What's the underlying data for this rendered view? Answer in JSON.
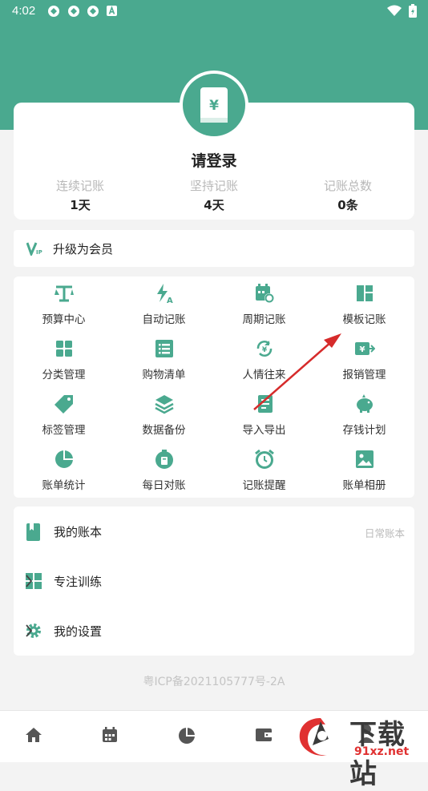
{
  "status_bar": {
    "time": "4:02"
  },
  "profile": {
    "login_text": "请登录",
    "stats": [
      {
        "label": "连续记账",
        "value": "1天"
      },
      {
        "label": "坚持记账",
        "value": "4天"
      },
      {
        "label": "记账总数",
        "value": "0条"
      }
    ]
  },
  "vip": {
    "label": "升级为会员",
    "badge": "VIP"
  },
  "features": [
    {
      "label": "预算中心",
      "icon": "scale-icon"
    },
    {
      "label": "自动记账",
      "icon": "flash-auto-icon"
    },
    {
      "label": "周期记账",
      "icon": "calendar-cycle-icon"
    },
    {
      "label": "模板记账",
      "icon": "template-icon"
    },
    {
      "label": "分类管理",
      "icon": "grid-icon"
    },
    {
      "label": "购物清单",
      "icon": "list-icon"
    },
    {
      "label": "人情往来",
      "icon": "exchange-icon"
    },
    {
      "label": "报销管理",
      "icon": "reimburse-icon"
    },
    {
      "label": "标签管理",
      "icon": "tag-icon"
    },
    {
      "label": "数据备份",
      "icon": "layers-icon"
    },
    {
      "label": "导入导出",
      "icon": "import-export-icon"
    },
    {
      "label": "存钱计划",
      "icon": "piggy-bank-icon"
    },
    {
      "label": "账单统计",
      "icon": "pie-chart-icon"
    },
    {
      "label": "每日对账",
      "icon": "clock-check-icon"
    },
    {
      "label": "记账提醒",
      "icon": "alarm-icon"
    },
    {
      "label": "账单相册",
      "icon": "photo-icon"
    }
  ],
  "menu": {
    "my_books": {
      "label": "我的账本",
      "value": "日常账本"
    },
    "focus": {
      "label": "专注训练"
    },
    "settings": {
      "label": "我的设置"
    }
  },
  "icp": "粤ICP备2021105777号-2A",
  "watermark": {
    "title": "下载站",
    "site": "91xz.net"
  },
  "colors": {
    "primary": "#4aa98f",
    "arrow": "#d62b2b"
  }
}
